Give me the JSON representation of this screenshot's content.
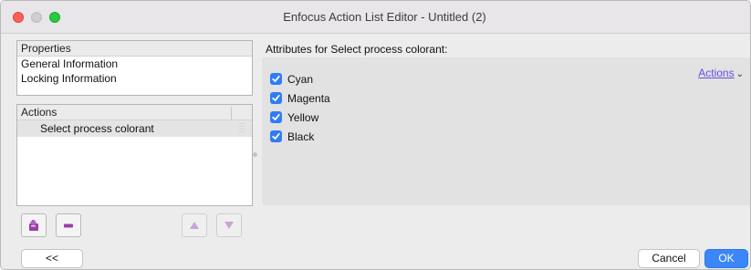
{
  "window": {
    "title": "Enfocus Action List Editor - Untitled (2)"
  },
  "properties": {
    "header": "Properties",
    "items": [
      "General Information",
      "Locking Information"
    ]
  },
  "actions_panel": {
    "header": "Actions",
    "items": [
      "Select process colorant"
    ]
  },
  "attributes": {
    "title": "Attributes for Select process colorant:",
    "actions_menu": "Actions",
    "colorants": [
      {
        "label": "Cyan",
        "checked": true
      },
      {
        "label": "Magenta",
        "checked": true
      },
      {
        "label": "Yellow",
        "checked": true
      },
      {
        "label": "Black",
        "checked": true
      }
    ]
  },
  "footer": {
    "collapse_label": "<<",
    "cancel_label": "Cancel",
    "ok_label": "OK"
  },
  "colors": {
    "accent": "#3b87f7",
    "checkbox": "#2f7cf6",
    "link": "#6a4de0",
    "add_icon": "#9b3fa8"
  },
  "icons": {
    "add_action": "add-action-icon",
    "remove_action": "remove-action-icon",
    "move_up": "move-up-icon",
    "move_down": "move-down-icon"
  }
}
